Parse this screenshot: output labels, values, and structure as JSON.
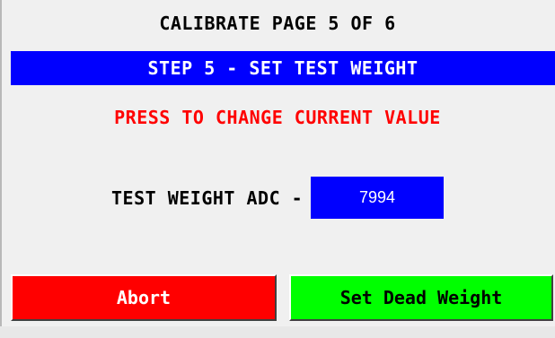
{
  "header": {
    "title": "CALIBRATE PAGE 5 OF 6"
  },
  "step": {
    "label": "STEP 5 - SET TEST WEIGHT"
  },
  "instruction": {
    "text": "PRESS TO CHANGE CURRENT VALUE"
  },
  "test_weight_adc": {
    "label": "TEST WEIGHT ADC -",
    "value": "7994"
  },
  "buttons": {
    "abort_label": "Abort",
    "set_dead_weight_label": "Set Dead Weight"
  },
  "colors": {
    "banner_blue": "#0000ff",
    "instruction_red": "#ff0000",
    "abort_red": "#ff0000",
    "set_green": "#00ff00",
    "background": "#f0f0f0"
  }
}
